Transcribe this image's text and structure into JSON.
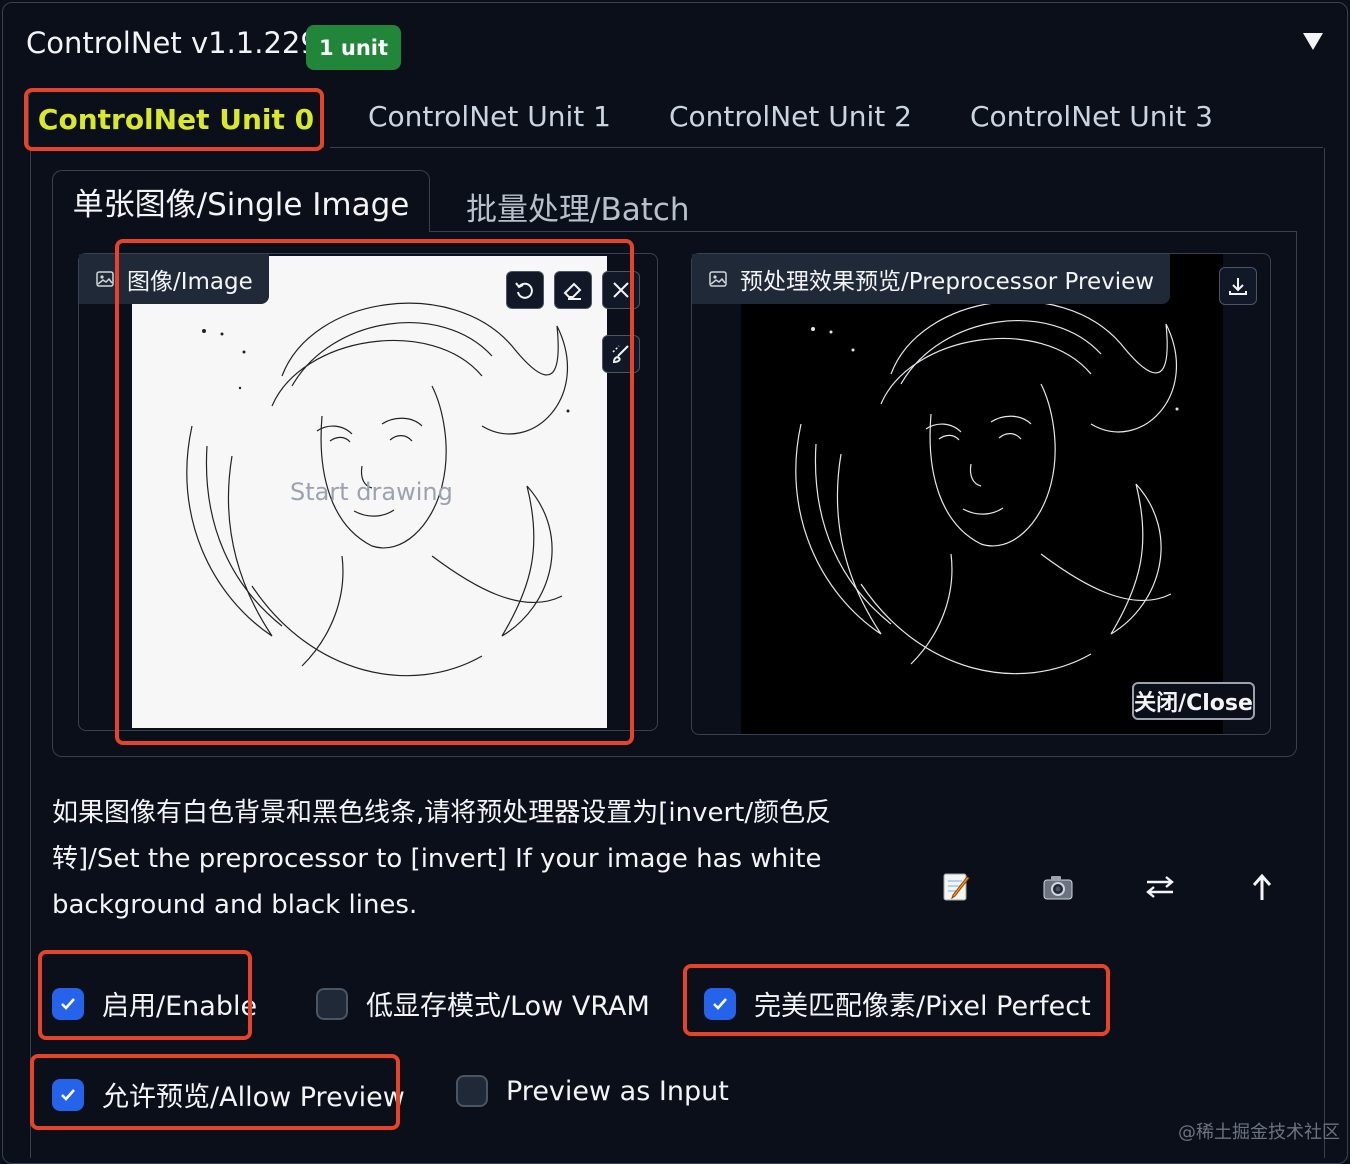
{
  "header": {
    "title": "ControlNet v1.1.229",
    "badge": "1 unit"
  },
  "unit_tabs": [
    {
      "label": "ControlNet Unit 0",
      "active": true
    },
    {
      "label": "ControlNet Unit 1",
      "active": false
    },
    {
      "label": "ControlNet Unit 2",
      "active": false
    },
    {
      "label": "ControlNet Unit 3",
      "active": false
    }
  ],
  "mode_tabs": [
    {
      "label": "单张图像/Single Image",
      "active": true
    },
    {
      "label": "批量处理/Batch",
      "active": false
    }
  ],
  "image_input": {
    "label": "图像/Image",
    "placeholder": "Start drawing",
    "icon": "image-icon"
  },
  "preprocessor_preview": {
    "label": "预处理效果预览/Preprocessor Preview",
    "close_label": "关闭/Close",
    "icon": "image-icon"
  },
  "tool_icons": [
    "undo-icon",
    "eraser-icon",
    "close-icon",
    "brush-icon",
    "download-icon"
  ],
  "description": "如果图像有白色背景和黑色线条,请将预处理器设置为[invert/颜色反转]/Set the preprocessor to [invert] If your image has white background and black lines.",
  "action_icons": [
    "memo-icon",
    "camera-icon",
    "swap-icon",
    "send-up-icon"
  ],
  "options": {
    "enable": {
      "label": "启用/Enable",
      "checked": true
    },
    "low_vram": {
      "label": "低显存模式/Low VRAM",
      "checked": false
    },
    "pixel_perfect": {
      "label": "完美匹配像素/Pixel Perfect",
      "checked": true
    },
    "allow_preview": {
      "label": "允许预览/Allow Preview",
      "checked": true
    },
    "preview_as_input": {
      "label": "Preview as Input",
      "checked": false
    }
  },
  "watermark": "@稀土掘金技术社区",
  "colors": {
    "accent": "#2563eb",
    "badge": "#22863a",
    "active_tab": "#d9e82a",
    "highlight": "#e5432a"
  }
}
